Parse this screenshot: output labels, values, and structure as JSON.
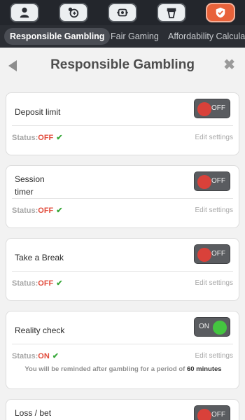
{
  "top_icons": [
    {
      "name": "user-icon"
    },
    {
      "name": "chat-support-icon"
    },
    {
      "name": "ticket-icon"
    },
    {
      "name": "cup-icon"
    },
    {
      "name": "shield-check-icon",
      "active": true
    }
  ],
  "tabs": [
    {
      "label": "Responsible Gambling",
      "active": true
    },
    {
      "label": "Fair Gaming"
    },
    {
      "label": "Affordability Calculator"
    }
  ],
  "header": {
    "title": "Responsible Gambling",
    "close": "✖"
  },
  "cards": [
    {
      "title": "Deposit limit",
      "toggle": "OFF",
      "status_label": "Status:",
      "status_value": "OFF",
      "edit": "Edit settings"
    },
    {
      "title": "Session timer",
      "title_line1": "Session",
      "title_line2": "timer",
      "toggle": "OFF",
      "status_label": "Status:",
      "status_value": "OFF",
      "edit": "Edit settings"
    },
    {
      "title": "Take a Break",
      "toggle": "OFF",
      "status_label": "Status:",
      "status_value": "OFF",
      "edit": "Edit settings"
    },
    {
      "title": "Reality check",
      "toggle": "ON",
      "status_label": "Status:",
      "status_value": "ON",
      "edit": "Edit settings",
      "note_prefix": "You will be reminded after gambling for a period of",
      "note_value": "60 minutes"
    },
    {
      "title": "Loss / bet",
      "toggle": "OFF"
    }
  ],
  "colors": {
    "accent": "#e8623a",
    "status_off": "#e14b3b",
    "toggle_on": "#44c540",
    "toggle_off": "#d9413a"
  }
}
